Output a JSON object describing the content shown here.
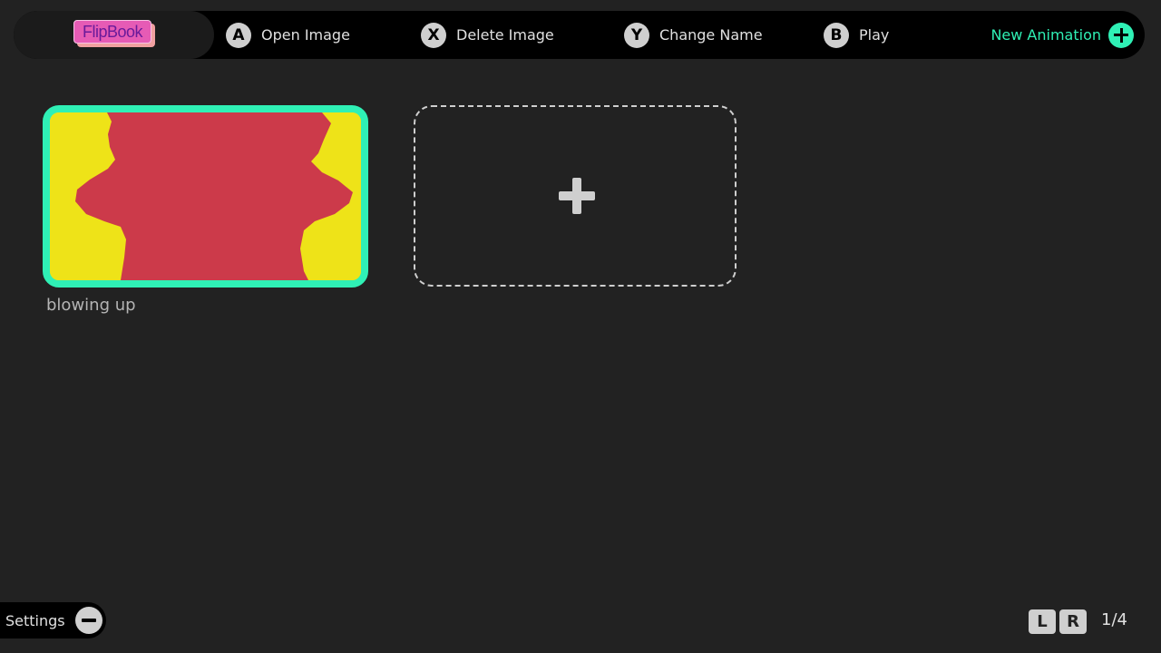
{
  "topbar": {
    "logo_text": "FlipBook",
    "actions": [
      {
        "button": "A",
        "label": "Open Image"
      },
      {
        "button": "X",
        "label": "Delete Image"
      },
      {
        "button": "Y",
        "label": "Change Name"
      },
      {
        "button": "B",
        "label": "Play"
      }
    ],
    "new_animation_label": "New Animation"
  },
  "animations": [
    {
      "title": "blowing up",
      "selected": true,
      "thumb_bg": "#eee318",
      "thumb_fg": "#cc3a4a"
    }
  ],
  "add_slot_icon": "plus-icon",
  "footer": {
    "settings_label": "Settings",
    "shoulder_left": "L",
    "shoulder_right": "R",
    "page_indicator": "1/4"
  },
  "colors": {
    "accent": "#2ff0b5",
    "background": "#222222",
    "logo_pink": "#e65bb5",
    "thumb_yellow": "#eee318",
    "thumb_red": "#cc3a4a"
  }
}
